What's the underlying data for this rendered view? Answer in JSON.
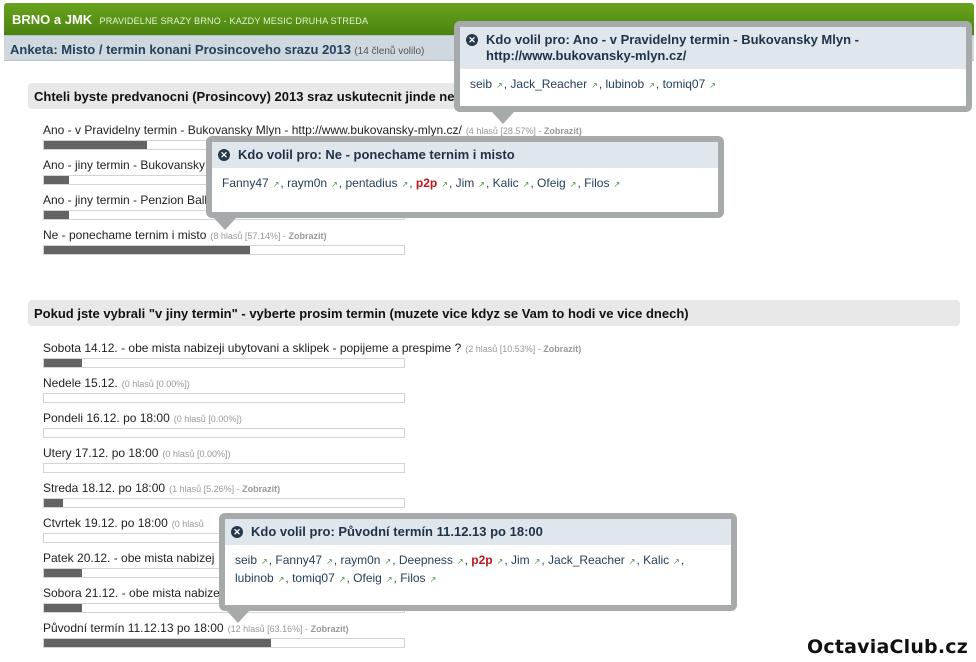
{
  "header": {
    "forum_name": "BRNO a JMK",
    "forum_desc": "PRAVIDELNE SRAZY BRNO - KAZDY MESIC DRUHA STREDA"
  },
  "poll": {
    "title": "Anketa: Misto / termin konani Prosincoveho srazu 2013",
    "members": "(14 členů volilo)"
  },
  "questions": [
    {
      "title": "Chteli byste predvanocni (Prosincovy) 2013 sraz uskutecnit jinde ne",
      "options": [
        {
          "label": "Ano - v Pravidelny termin - Bukovansky Mlyn - http://www.bukovansky-mlyn.cz/",
          "meta": "(4 hlasů [28.57%] -",
          "show": "Zobrazit)",
          "pct": 28.57
        },
        {
          "label": "Ano - jiny termin - Bukovansky M",
          "meta": "",
          "show": "",
          "pct": 7
        },
        {
          "label": "Ano - jiny termin - Penzion Ballo",
          "meta": "",
          "show": "",
          "pct": 7
        },
        {
          "label": "Ne - ponechame ternim i misto",
          "meta": "(8 hlasů [57.14%] -",
          "show": "Zobrazit)",
          "pct": 57.14
        }
      ]
    },
    {
      "title": "Pokud jste vybrali \"v jiny termin\" - vyberte prosim termin (muzete vice kdyz se Vam to hodi ve vice dnech)",
      "options": [
        {
          "label": "Sobota 14.12. - obe mista nabizeji ubytovani a sklipek - popijeme a prespime ?",
          "meta": "(2 hlasů [10.53%] -",
          "show": "Zobrazit)",
          "pct": 10.53
        },
        {
          "label": "Nedele 15.12.",
          "meta": "(0 hlasů [0.00%])",
          "show": "",
          "pct": 0
        },
        {
          "label": "Pondeli 16.12. po 18:00",
          "meta": "(0 hlasů [0.00%])",
          "show": "",
          "pct": 0
        },
        {
          "label": "Utery 17.12. po 18:00",
          "meta": "(0 hlasů [0.00%])",
          "show": "",
          "pct": 0
        },
        {
          "label": "Streda 18.12. po 18:00",
          "meta": "(1 hlasů [5.26%] -",
          "show": "Zobrazit)",
          "pct": 5.26
        },
        {
          "label": "Ctvrtek 19.12. po 18:00",
          "meta": "(0 hlasů",
          "show": "",
          "pct": 0
        },
        {
          "label": "Patek 20.12. - obe mista nabizej",
          "meta": "",
          "show": "",
          "pct": 10.53
        },
        {
          "label": "Sobora 21.12. - obe mista nabize",
          "meta": "",
          "show": "",
          "pct": 10.53
        },
        {
          "label": "Původní termín 11.12.13 po 18:00",
          "meta": "(12 hlasů [63.16%] -",
          "show": "Zobrazit)",
          "pct": 63.16
        }
      ]
    }
  ],
  "popups": [
    {
      "title": "Kdo volil pro: Ano - v Pravidelny termin - Bukovansky Mlyn - http://www.bukovansky-mlyn.cz/",
      "voters": [
        {
          "name": "seib",
          "hl": false
        },
        {
          "name": "Jack_Reacher",
          "hl": false
        },
        {
          "name": "lubinob",
          "hl": false
        },
        {
          "name": "tomiq07",
          "hl": false
        }
      ]
    },
    {
      "title": "Kdo volil pro: Ne - ponechame ternim i misto",
      "voters": [
        {
          "name": "Fanny47",
          "hl": false
        },
        {
          "name": "raym0n",
          "hl": false
        },
        {
          "name": "pentadius",
          "hl": false
        },
        {
          "name": "p2p",
          "hl": true
        },
        {
          "name": "Jim",
          "hl": false
        },
        {
          "name": "Kalic",
          "hl": false
        },
        {
          "name": "Ofeig",
          "hl": false
        },
        {
          "name": "Filos",
          "hl": false
        }
      ]
    },
    {
      "title": "Kdo volil pro: Původní termín 11.12.13 po 18:00",
      "voters": [
        {
          "name": "seib",
          "hl": false
        },
        {
          "name": "Fanny47",
          "hl": false
        },
        {
          "name": "raym0n",
          "hl": false
        },
        {
          "name": "Deepness",
          "hl": false
        },
        {
          "name": "p2p",
          "hl": true
        },
        {
          "name": "Jim",
          "hl": false
        },
        {
          "name": "Jack_Reacher",
          "hl": false
        },
        {
          "name": "Kalic",
          "hl": false
        },
        {
          "name": "lubinob",
          "hl": false
        },
        {
          "name": "tomiq07",
          "hl": false
        },
        {
          "name": "Ofeig",
          "hl": false
        },
        {
          "name": "Filos",
          "hl": false
        }
      ]
    }
  ],
  "watermark": "OctaviaClub.cz"
}
